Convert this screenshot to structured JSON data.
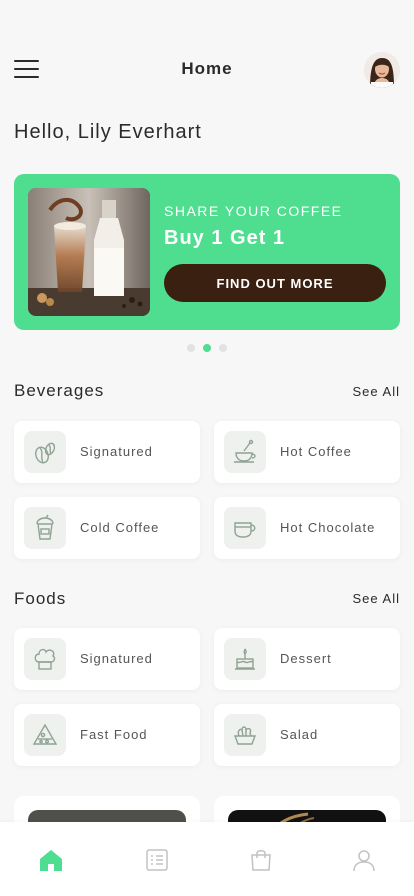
{
  "header": {
    "title": "Home",
    "menu_icon": "hamburger-menu-icon",
    "avatar_icon": "user-avatar"
  },
  "greeting": "Hello, Lily Everhart",
  "banner": {
    "kicker": "SHARE YOUR COFFEE",
    "title": "Buy 1 Get 1",
    "button_label": "FIND OUT MORE",
    "background_color": "#4fdd8f",
    "button_color": "#3a2010",
    "slides_total": 3,
    "active_slide": 2
  },
  "beverages": {
    "title": "Beverages",
    "see_all": "See All",
    "items": [
      {
        "label": "Signatured",
        "icon": "coffee-beans-icon"
      },
      {
        "label": "Hot Coffee",
        "icon": "coffee-cup-icon"
      },
      {
        "label": "Cold Coffee",
        "icon": "iced-drink-icon"
      },
      {
        "label": "Hot Chocolate",
        "icon": "mug-icon"
      }
    ]
  },
  "foods": {
    "title": "Foods",
    "see_all": "See All",
    "items": [
      {
        "label": "Signatured",
        "icon": "chef-hat-icon"
      },
      {
        "label": "Dessert",
        "icon": "cake-icon"
      },
      {
        "label": "Fast Food",
        "icon": "pizza-slice-icon"
      },
      {
        "label": "Salad",
        "icon": "salad-bowl-icon"
      }
    ]
  },
  "tabbar": {
    "active_color": "#4fdd8f",
    "items": [
      {
        "name": "home",
        "icon": "home-icon",
        "active": true
      },
      {
        "name": "orders",
        "icon": "list-icon",
        "active": false
      },
      {
        "name": "cart",
        "icon": "shopping-bag-icon",
        "active": false
      },
      {
        "name": "profile",
        "icon": "profile-icon",
        "active": false
      }
    ]
  }
}
